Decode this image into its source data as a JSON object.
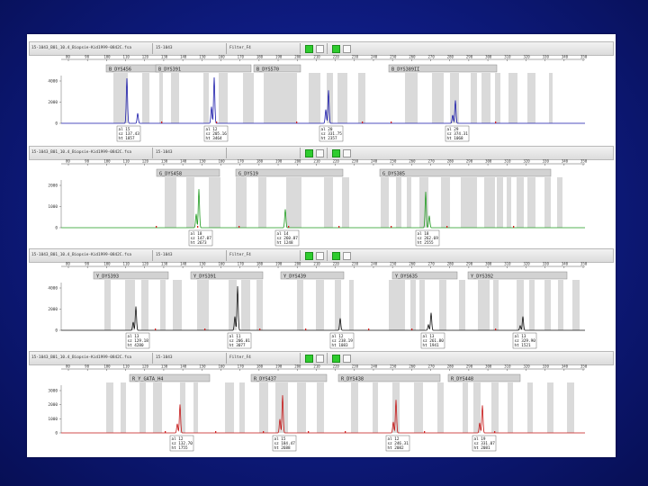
{
  "panels": [
    {
      "file": "15-1043_B01_10.4_Biopsie-Kid1999-0842C.fsa",
      "sample": "15-1043",
      "filter": "Filter_F4",
      "color": "#1a1aaa",
      "yticks": [
        "4000",
        "2000",
        "0"
      ],
      "xticks": [
        "80",
        "90",
        "100",
        "110",
        "120",
        "130",
        "140",
        "150",
        "160",
        "170",
        "180",
        "190",
        "200",
        "210",
        "220",
        "230",
        "240",
        "250",
        "260",
        "270",
        "280",
        "290",
        "300",
        "310",
        "320",
        "330",
        "340",
        "350"
      ],
      "markers": [
        "B_DYS456",
        "B_DYS391",
        "B_DYS570",
        "B_DYS389II"
      ],
      "peaks": [
        {
          "allele": "al 15",
          "size": "sz 137.43",
          "height": "ht 1857"
        },
        {
          "allele": "al 12",
          "size": "sz 205.16",
          "height": "ht 3464"
        },
        {
          "allele": "al 20",
          "size": "sz 331.75",
          "height": "ht 2357"
        },
        {
          "allele": "al 29",
          "size": "sz 374.31",
          "height": "ht 1068"
        }
      ]
    },
    {
      "file": "15-1043_B01_10.4_Biopsie-Kid1999-0842C.fsa",
      "sample": "15-1043",
      "filter": "",
      "color": "#1f9a1f",
      "yticks": [
        "2000",
        "1000",
        "0"
      ],
      "xticks": [
        "80",
        "90",
        "100",
        "110",
        "120",
        "130",
        "140",
        "150",
        "160",
        "170",
        "180",
        "190",
        "200",
        "210",
        "220",
        "230",
        "240",
        "250",
        "260",
        "270",
        "280",
        "290",
        "300",
        "310",
        "320",
        "330",
        "340",
        "350"
      ],
      "markers": [
        "G_DYS458",
        "G_DYS19",
        "G_DYS385"
      ],
      "peaks": [
        {
          "allele": "al 18",
          "size": "sz 147.07",
          "height": "ht 2673"
        },
        {
          "allele": "al 14",
          "size": "sz 260.87",
          "height": "ht 1248"
        },
        {
          "allele": "al 18",
          "size": "sz 262.69",
          "height": "ht 2555"
        }
      ]
    },
    {
      "file": "15-1043_B01_10.4_Biopsie-Kid1999-0842C.fsa",
      "sample": "15-1043",
      "filter": "Filter_F4",
      "color": "#111111",
      "yticks": [
        "4000",
        "2000",
        "0"
      ],
      "xticks": [
        "80",
        "90",
        "100",
        "110",
        "120",
        "130",
        "140",
        "150",
        "160",
        "170",
        "180",
        "190",
        "200",
        "210",
        "220",
        "230",
        "240",
        "250",
        "260",
        "270",
        "280",
        "290",
        "300",
        "310",
        "320",
        "330",
        "340",
        "350"
      ],
      "markers": [
        "Y_DYS393",
        "Y_DYS391",
        "Y_DYS439",
        "Y_DYS635",
        "Y_DYS392"
      ],
      "peaks": [
        {
          "allele": "al 13",
          "size": "sz 129.18",
          "height": "ht 4280"
        },
        {
          "allele": "al 11",
          "size": "sz 206.81",
          "height": "ht 3077"
        },
        {
          "allele": "al 12",
          "size": "sz 238.19",
          "height": "ht 1083"
        },
        {
          "allele": "al 13",
          "size": "sz 261.80",
          "height": "ht 1941"
        },
        {
          "allele": "al 13",
          "size": "sz 329.90",
          "height": "ht 1521"
        }
      ]
    },
    {
      "file": "15-1043_B01_10.4_Biopsie-Kid1999-0842C.fsa",
      "sample": "15-1043",
      "filter": "Filter_F4",
      "color": "#c41414",
      "yticks": [
        "3000",
        "2000",
        "1000",
        "0"
      ],
      "xticks": [
        "80",
        "90",
        "100",
        "110",
        "120",
        "130",
        "140",
        "150",
        "160",
        "170",
        "180",
        "190",
        "200",
        "210",
        "220",
        "230",
        "240",
        "250",
        "260",
        "270",
        "280",
        "290",
        "300",
        "310",
        "320",
        "330",
        "340",
        "350"
      ],
      "markers": [
        "R_Y_GATA_H4",
        "R_DYS437",
        "R_DYS438",
        "R_DYS448"
      ],
      "peaks": [
        {
          "allele": "al 12",
          "size": "sz 132.70",
          "height": "ht 1755"
        },
        {
          "allele": "al 15",
          "size": "sz 184.47",
          "height": "ht 2688"
        },
        {
          "allele": "al 12",
          "size": "sz 246.31",
          "height": "ht 2082"
        },
        {
          "allele": "al 19",
          "size": "sz 331.07",
          "height": "ht 2081"
        }
      ]
    }
  ]
}
